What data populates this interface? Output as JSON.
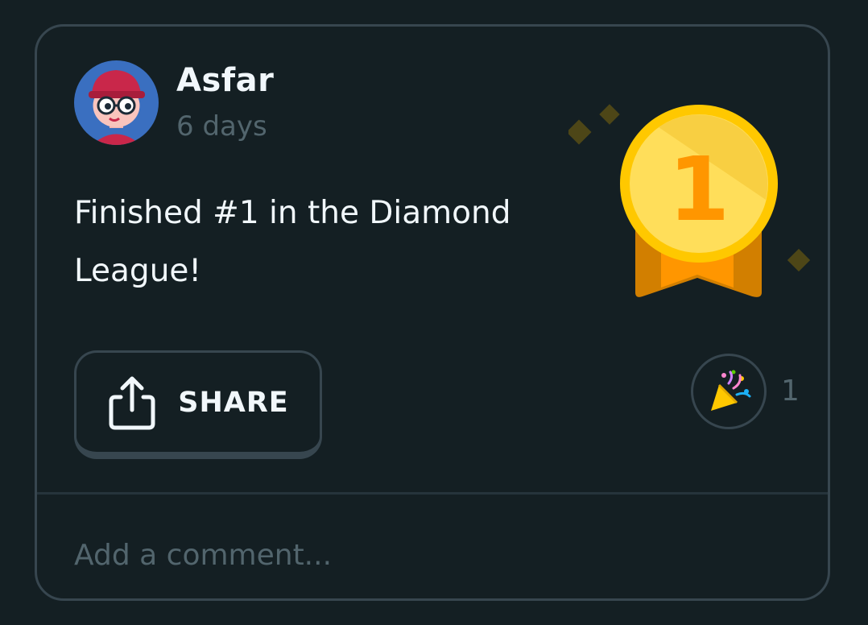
{
  "post": {
    "username": "Asfar",
    "timestamp": "6 days",
    "message": "Finished #1 in the Diamond League!",
    "medal": {
      "icon": "gold-medal-icon",
      "rank": "1"
    },
    "avatar_icon": "user-avatar-icon"
  },
  "actions": {
    "share_label": "SHARE",
    "share_icon": "share-icon",
    "reaction_icon": "party-popper-icon",
    "reaction_count": "1"
  },
  "comment": {
    "placeholder": "Add a comment..."
  },
  "colors": {
    "background": "#141f23",
    "border": "#37464f",
    "text": "#f1f7fb",
    "muted": "#52656d",
    "gold": "#ffc800",
    "orange": "#ff9600"
  }
}
